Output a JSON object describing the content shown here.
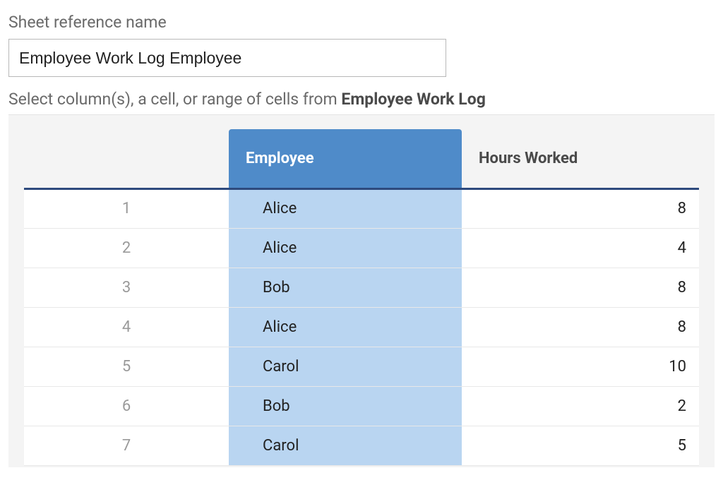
{
  "form": {
    "sheet_ref_label": "Sheet reference name",
    "sheet_ref_value": "Employee Work Log Employee",
    "instruction_prefix": "Select column(s), a cell, or range of cells from ",
    "instruction_bold": "Employee Work Log"
  },
  "columns": {
    "employee": "Employee",
    "hours": "Hours Worked"
  },
  "selected_column": "employee",
  "rows": [
    {
      "n": "1",
      "employee": "Alice",
      "hours": "8"
    },
    {
      "n": "2",
      "employee": "Alice",
      "hours": "4"
    },
    {
      "n": "3",
      "employee": "Bob",
      "hours": "8"
    },
    {
      "n": "4",
      "employee": "Alice",
      "hours": "8"
    },
    {
      "n": "5",
      "employee": "Carol",
      "hours": "10"
    },
    {
      "n": "6",
      "employee": "Bob",
      "hours": "2"
    },
    {
      "n": "7",
      "employee": "Carol",
      "hours": "5"
    }
  ]
}
